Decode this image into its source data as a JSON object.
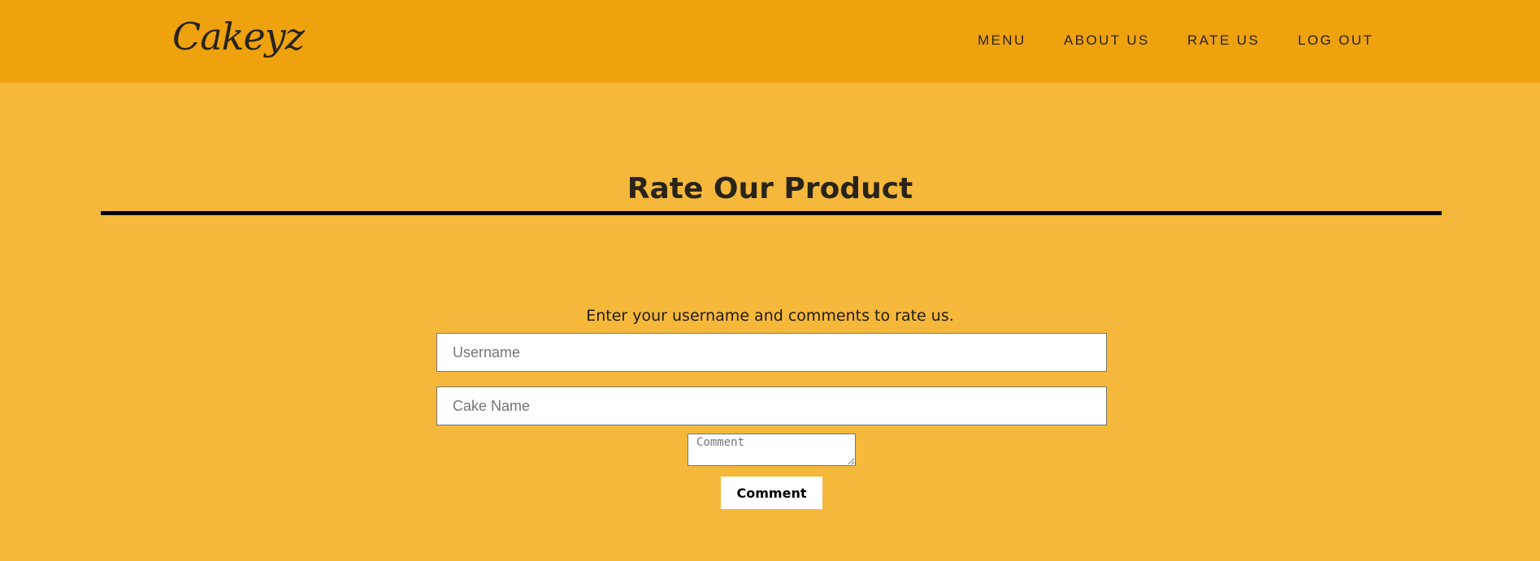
{
  "header": {
    "logo": "Cakeyz",
    "nav": [
      "MENU",
      "ABOUT US",
      "RATE US",
      "LOG OUT"
    ]
  },
  "main": {
    "title": "Rate Our Product",
    "instructions": "Enter your username and comments to rate us.",
    "username_placeholder": "Username",
    "cake_name_placeholder": "Cake Name",
    "comment_placeholder": "Comment",
    "submit_label": "Comment"
  },
  "colors": {
    "header_bg": "#EEA20E",
    "page_bg": "#F5B83B"
  }
}
